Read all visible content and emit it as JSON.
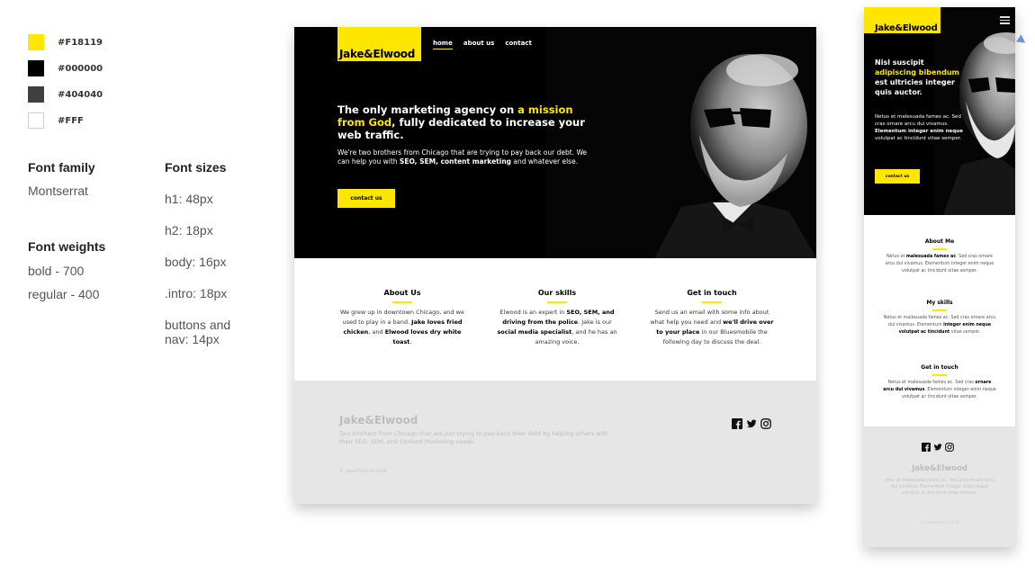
{
  "palette": [
    {
      "hex": "#F18119",
      "label": "#F18119",
      "fill": "#ffe600"
    },
    {
      "hex": "#000000",
      "label": "#000000",
      "fill": "#000000"
    },
    {
      "hex": "#404040",
      "label": "#404040",
      "fill": "#404040"
    },
    {
      "hex": "#FFF",
      "label": "#FFF",
      "fill": "#ffffff"
    }
  ],
  "guide": {
    "font_family_title": "Font family",
    "font_family_value": "Montserrat",
    "font_weights_title": "Font weights",
    "weight_bold": "bold - 700",
    "weight_regular": "regular - 400",
    "font_sizes_title": "Font sizes",
    "size_h1": "h1: 48px",
    "size_h2": "h2: 18px",
    "size_body": "body: 16px",
    "size_intro": ".intro: 18px",
    "size_buttons_1": "buttons and",
    "size_buttons_2": "nav: 14px"
  },
  "desktop": {
    "logo": "Jake&Elwood",
    "nav": [
      "home",
      "about us",
      "contact"
    ],
    "headline_a": "The only marketing agency on ",
    "headline_hl": "a mission from God",
    "headline_b": ", fully dedicated to increase your web traffic.",
    "intro_a": "We're two brothers from Chicago that are trying to pay back our debt. We can help you with ",
    "intro_b": "SEO, SEM, content marketing",
    "intro_c": " and whatever else.",
    "cta": "contact us",
    "about": {
      "title": "About Us",
      "t1": "We grew up in downtown Chicago, and we used to play in a band. ",
      "b1": "Jake loves fried chicken",
      "t2": ", and ",
      "b2": "Elwood loves dry white toast",
      "t3": "."
    },
    "skills": {
      "title": "Our skills",
      "t1": "Elwood is an expert in ",
      "b1": "SEO, SEM, and driving from the police",
      "t2": ". Jake is our ",
      "b2": "social media specialist",
      "t3": ", and he has an amazing voice."
    },
    "contact": {
      "title": "Get in touch",
      "t1": "Send us an email with some info about what help you need and ",
      "b1": "we'll drive over to your place",
      "t2": " in our Bluesmobile the following day to discuss the deal."
    },
    "footer_logo": "Jake&Elwood",
    "footer_text": "Two brothers from Chicago that are just trying to pay back their debt by helping others with their SEO, SEM, and Content Marketing needs.",
    "footer_copy": "© Jake&Elwood 2018"
  },
  "mobile": {
    "logo": "Jake&Elwood",
    "headline_a": "Nisl suscipit ",
    "headline_hl": "adipiscing bibendum",
    "headline_b": " est ultricies integer quis auctor.",
    "intro_a": "Netus et malesuada fames ac. Sed cras ornare arcu dui vivamus. ",
    "intro_b": "Elementum integer enim neque",
    "intro_c": " volutpat ac tincidunt vitae semper.",
    "cta": "contact us",
    "about": {
      "title": "About Me",
      "t1": "Netus et ",
      "b1": "malesuada fames ac",
      "t2": ". Sed cras ornare arcu dui vivamus. Elementum integer enim neque volutpat ac tincidunt vitae semper."
    },
    "skills": {
      "title": "My skills",
      "t1": "Netus et malesuada fames ac. Sed cras ornare arcu dui vivamus. Elementum ",
      "b1": "integer enim neque volutpat ac tincidunt",
      "t2": " vitae semper."
    },
    "contact": {
      "title": "Get in touch",
      "t1": "Netus et malesuada fames ac. Sed cras ",
      "b1": "ornare arcu dui vivamus",
      "t2": ". Elementum integer enim neque volutpat ac tincidunt vitae semper."
    },
    "footer_logo": "Jake&Elwood",
    "footer_text": "shus et malesuada fames ac. Sed cras ornare arcu dui vivamus. Elementum integer enim neque volutpat ac tincidunt vitae semper.",
    "footer_copy": "© Jake&Elwood 2018"
  },
  "colors": {
    "accent": "#ffe600",
    "black": "#000000",
    "dark": "#404040",
    "white": "#ffffff",
    "footer_bg": "#e6e6e6"
  },
  "icons": [
    "facebook-icon",
    "twitter-icon",
    "instagram-icon",
    "hamburger-menu-icon"
  ]
}
